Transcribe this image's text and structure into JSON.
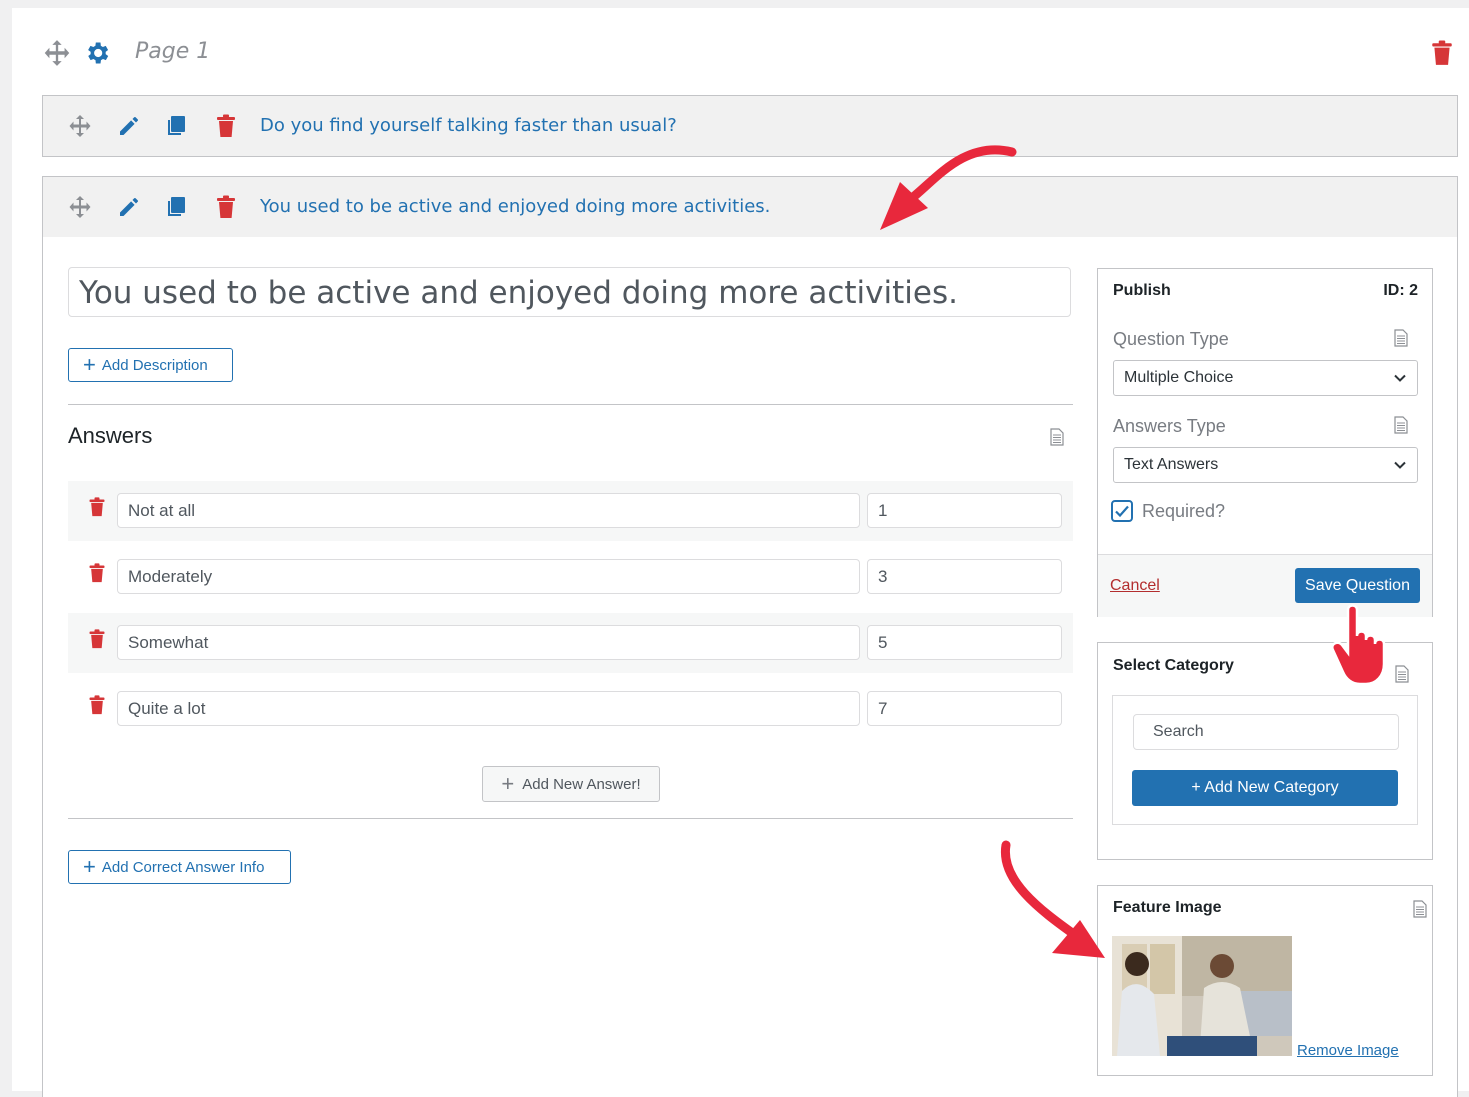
{
  "page": {
    "title": "Page 1"
  },
  "questions": [
    {
      "title": "Do you find yourself talking faster than usual?"
    },
    {
      "title": "You used to be active and enjoyed doing more activities."
    }
  ],
  "editor": {
    "title_value": "You used to be active and enjoyed doing more activities.",
    "add_description_label": "Add Description",
    "answers_heading": "Answers",
    "answers": [
      {
        "text": "Not at all",
        "value": "1"
      },
      {
        "text": "Moderately",
        "value": "3"
      },
      {
        "text": "Somewhat",
        "value": "5"
      },
      {
        "text": "Quite a lot",
        "value": "7"
      }
    ],
    "add_answer_label": "Add New Answer!",
    "add_correct_info_label": "Add Correct Answer Info"
  },
  "publish": {
    "title": "Publish",
    "id_label": "ID: 2",
    "question_type_label": "Question Type",
    "question_type_value": "Multiple Choice",
    "answers_type_label": "Answers Type",
    "answers_type_value": "Text Answers",
    "required_label": "Required?",
    "required_checked": true,
    "cancel_label": "Cancel",
    "save_label": "Save Question"
  },
  "category": {
    "title": "Select Category",
    "search_placeholder": "Search",
    "add_label": "+ Add New Category"
  },
  "feature_image": {
    "title": "Feature Image",
    "remove_label": "Remove Image"
  },
  "colors": {
    "accent": "#2271b1",
    "danger": "#d63638",
    "annotation": "#e8283c"
  }
}
